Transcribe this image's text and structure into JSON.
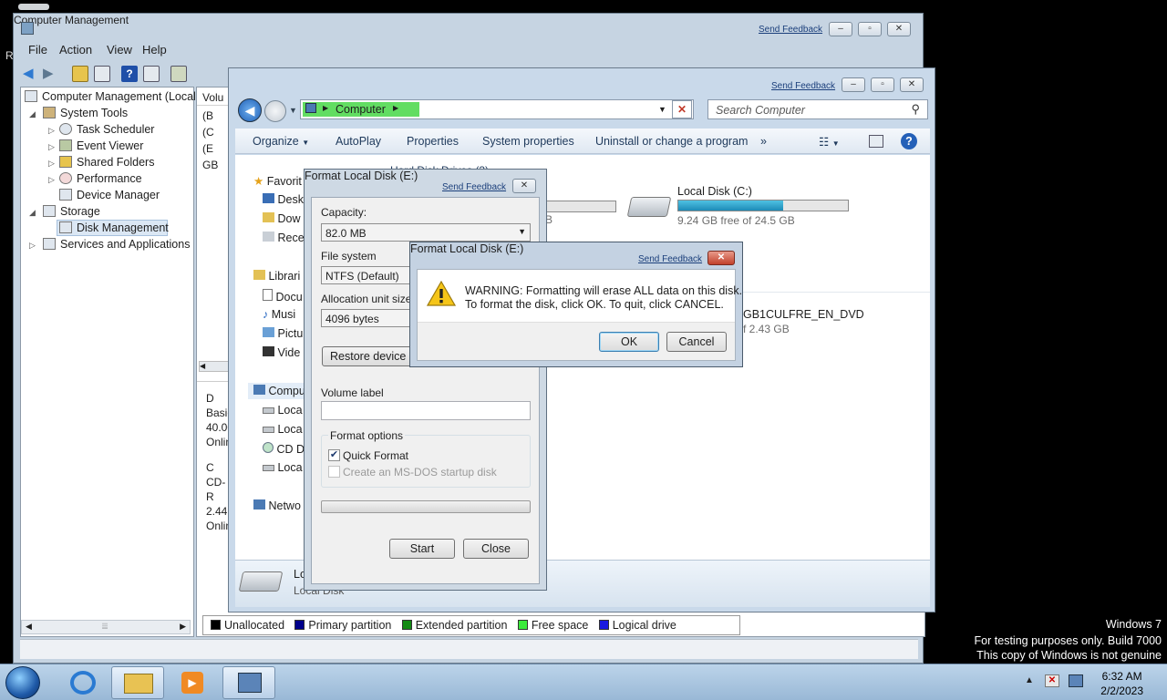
{
  "desktop": {
    "fragment": "R",
    "watermark": [
      "Windows 7",
      "For testing purposes only. Build 7000",
      "This copy of Windows is not genuine"
    ]
  },
  "computer_management": {
    "title": "Computer Management",
    "send_feedback": "Send Feedback",
    "menus": [
      "File",
      "Action",
      "View",
      "Help"
    ],
    "tree": {
      "root": "Computer Management (Local",
      "system_tools": "System Tools",
      "task_scheduler": "Task Scheduler",
      "event_viewer": "Event Viewer",
      "shared_folders": "Shared Folders",
      "performance": "Performance",
      "device_manager": "Device Manager",
      "storage": "Storage",
      "disk_management": "Disk Management",
      "services": "Services and Applications"
    },
    "volume_header": "Volu",
    "volume_rows": [
      "(B",
      "(C",
      "(E",
      "GB"
    ],
    "disk0": [
      "D",
      "Basic",
      "40.00",
      "Onlin"
    ],
    "cdrom": [
      "C",
      "CD-R",
      "2.44",
      "Onlin"
    ],
    "legend": [
      {
        "label": "Unallocated",
        "color": "#000000"
      },
      {
        "label": "Primary partition",
        "color": "#00008b"
      },
      {
        "label": "Extended partition",
        "color": "#138a13"
      },
      {
        "label": "Free space",
        "color": "#3bea3b"
      },
      {
        "label": "Logical drive",
        "color": "#1a1ae0"
      }
    ]
  },
  "explorer": {
    "send_feedback": "Send Feedback",
    "breadcrumb": "Computer",
    "search_placeholder": "Search Computer",
    "commands": [
      "Organize",
      "AutoPlay",
      "Properties",
      "System properties",
      "Uninstall or change a program",
      "»"
    ],
    "nav": {
      "favorites": "Favorit",
      "desktop": "Desk",
      "downloads": "Dow",
      "recent": "Rece",
      "libraries": "Librari",
      "documents": "Docu",
      "music": "Musi",
      "pictures": "Pictu",
      "videos": "Vide",
      "computer": "Compu",
      "local1": "Loca",
      "local2": "Loca",
      "cd": "CD D",
      "local3": "Loca",
      "network": "Netwo"
    },
    "group_header": "Hard Disk Drives (3)",
    "drive_c": {
      "name": "Local Disk (C:)",
      "free": "9.24 GB free of 24.5 GB",
      "used_fraction": 0.62
    },
    "drive_left_tail": "B",
    "dvd": {
      "name": "GB1CULFRE_EN_DVD",
      "free": "f 2.43 GB"
    },
    "details": {
      "name": "Lo",
      "type": "Local Disk"
    }
  },
  "format_dialog": {
    "title": "Format Local Disk (E:)",
    "send_feedback": "Send Feedback",
    "capacity_label": "Capacity:",
    "capacity_value": "82.0 MB",
    "filesystem_label": "File system",
    "filesystem_value": "NTFS (Default)",
    "allocation_label": "Allocation unit size",
    "allocation_value": "4096 bytes",
    "restore_button": "Restore device de",
    "volume_label": "Volume label",
    "volume_value": "",
    "options_title": "Format options",
    "quick_format": "Quick Format",
    "quick_format_checked": true,
    "msdos_disk": "Create an MS-DOS startup disk",
    "start_button": "Start",
    "close_button": "Close",
    "progress": 0
  },
  "warning_dialog": {
    "title": "Format Local Disk (E:)",
    "send_feedback": "Send Feedback",
    "line1": "WARNING: Formatting will erase ALL data on this disk.",
    "line2": "To format the disk, click OK. To quit, click CANCEL.",
    "ok_button": "OK",
    "cancel_button": "Cancel"
  },
  "taskbar": {
    "time": "6:32 AM",
    "date": "2/2/2023"
  },
  "colors": {
    "accent": "#1d8bb7",
    "address_highlight": "#62dd62",
    "close_red": "#c2412c"
  }
}
